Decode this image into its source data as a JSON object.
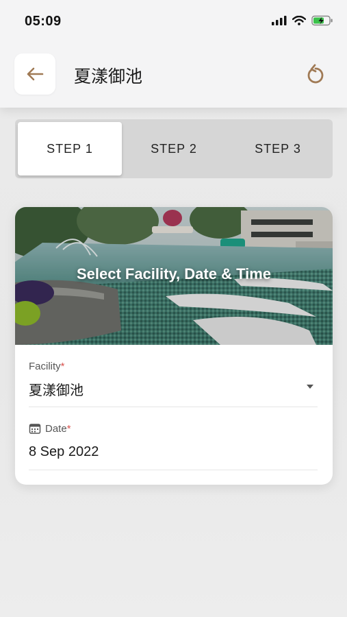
{
  "status_bar": {
    "time": "05:09"
  },
  "header": {
    "title": "夏漾御池"
  },
  "stepper": {
    "steps": [
      "STEP 1",
      "STEP 2",
      "STEP 3"
    ],
    "active_index": 0
  },
  "card": {
    "banner_title": "Select Facility, Date & Time",
    "facility": {
      "label": "Facility",
      "required_mark": "*",
      "value": "夏漾御池"
    },
    "date": {
      "label": "Date",
      "required_mark": "*",
      "value": "8 Sep 2022"
    }
  },
  "colors": {
    "accent": "#a07a55",
    "required": "#d9534f",
    "stepper_bg": "#d6d6d6"
  },
  "icons": [
    "signal-icon",
    "wifi-icon",
    "battery-icon",
    "back-arrow-icon",
    "refresh-icon",
    "calendar-icon",
    "dropdown-arrow-icon"
  ]
}
